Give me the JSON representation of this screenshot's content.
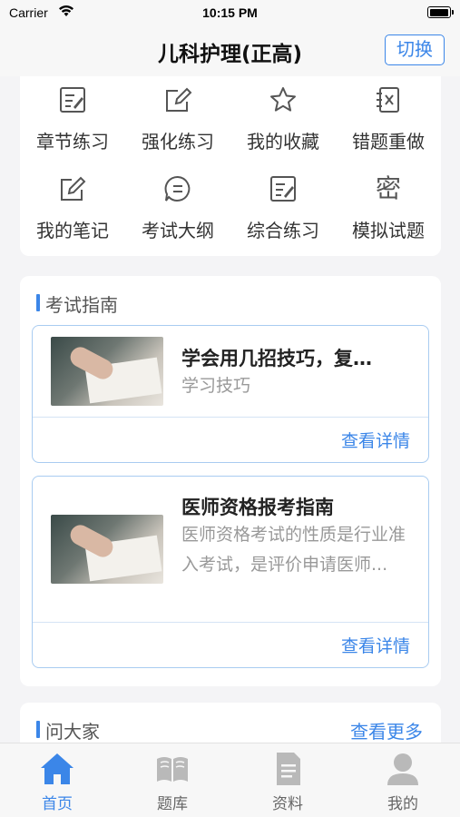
{
  "status_bar": {
    "carrier": "Carrier",
    "time": "10:15 PM",
    "battery_level": 1.0
  },
  "navbar": {
    "title": "儿科护理(正高)",
    "switch_label": "切换"
  },
  "grid": {
    "items": [
      {
        "label": "章节练习",
        "icon": "edit-list-icon"
      },
      {
        "label": "强化练习",
        "icon": "pencil-square-icon"
      },
      {
        "label": "我的收藏",
        "icon": "star-icon"
      },
      {
        "label": "错题重做",
        "icon": "wrong-answer-icon"
      },
      {
        "label": "我的笔记",
        "icon": "note-pencil-icon"
      },
      {
        "label": "考试大纲",
        "icon": "chat-bubble-icon"
      },
      {
        "label": "综合练习",
        "icon": "edit-list-icon"
      },
      {
        "label": "模拟试题",
        "icon": "mi-character-icon",
        "glyph": "密"
      }
    ]
  },
  "guide": {
    "section_title": "考试指南",
    "articles": [
      {
        "title": "学会用几招技巧，复…",
        "subtitle": "学习技巧",
        "more": "查看详情"
      },
      {
        "title": "医师资格报考指南",
        "subtitle": "医师资格考试的性质是行业准入考试，是评价申请医师...",
        "more": "查看详情"
      }
    ]
  },
  "ask": {
    "section_title": "问大家",
    "more": "查看更多"
  },
  "tabbar": {
    "tabs": [
      {
        "label": "首页",
        "icon": "home-icon",
        "active": true
      },
      {
        "label": "题库",
        "icon": "book-icon",
        "active": false
      },
      {
        "label": "资料",
        "icon": "document-icon",
        "active": false
      },
      {
        "label": "我的",
        "icon": "user-icon",
        "active": false
      }
    ]
  },
  "colors": {
    "accent": "#3b86e8",
    "inactive_tab": "#b9b9b9",
    "card_border": "#a9ccf1"
  }
}
